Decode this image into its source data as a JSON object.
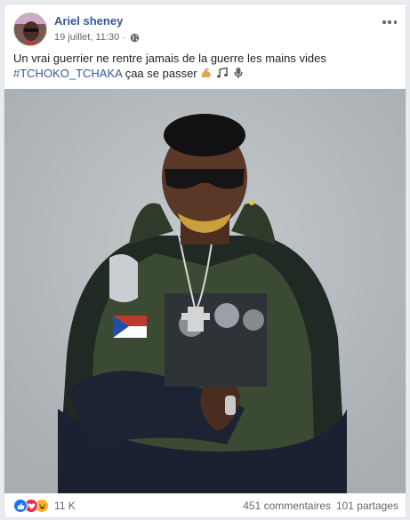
{
  "post": {
    "author": "Ariel sheney",
    "date": "19 juillet, 11:30",
    "separator": "·",
    "text": "Un vrai guerrier ne rentre jamais de la guerre les mains vides",
    "hashtag": "#TCHOKO_TCHAKA",
    "text_after": " çaa se passer ",
    "emojis": [
      "flexed-biceps-icon",
      "musical-notes-icon",
      "microphone-icon"
    ],
    "privacy_icon": "globe-icon"
  },
  "footer": {
    "reactions": [
      "like-reaction-icon",
      "love-reaction-icon",
      "haha-reaction-icon"
    ],
    "reaction_count": "11 K",
    "comments": "451 commentaires",
    "shares": "101 partages"
  },
  "colors": {
    "link": "#365899",
    "muted": "#616770",
    "photo_bg": "#b3b9bd"
  }
}
